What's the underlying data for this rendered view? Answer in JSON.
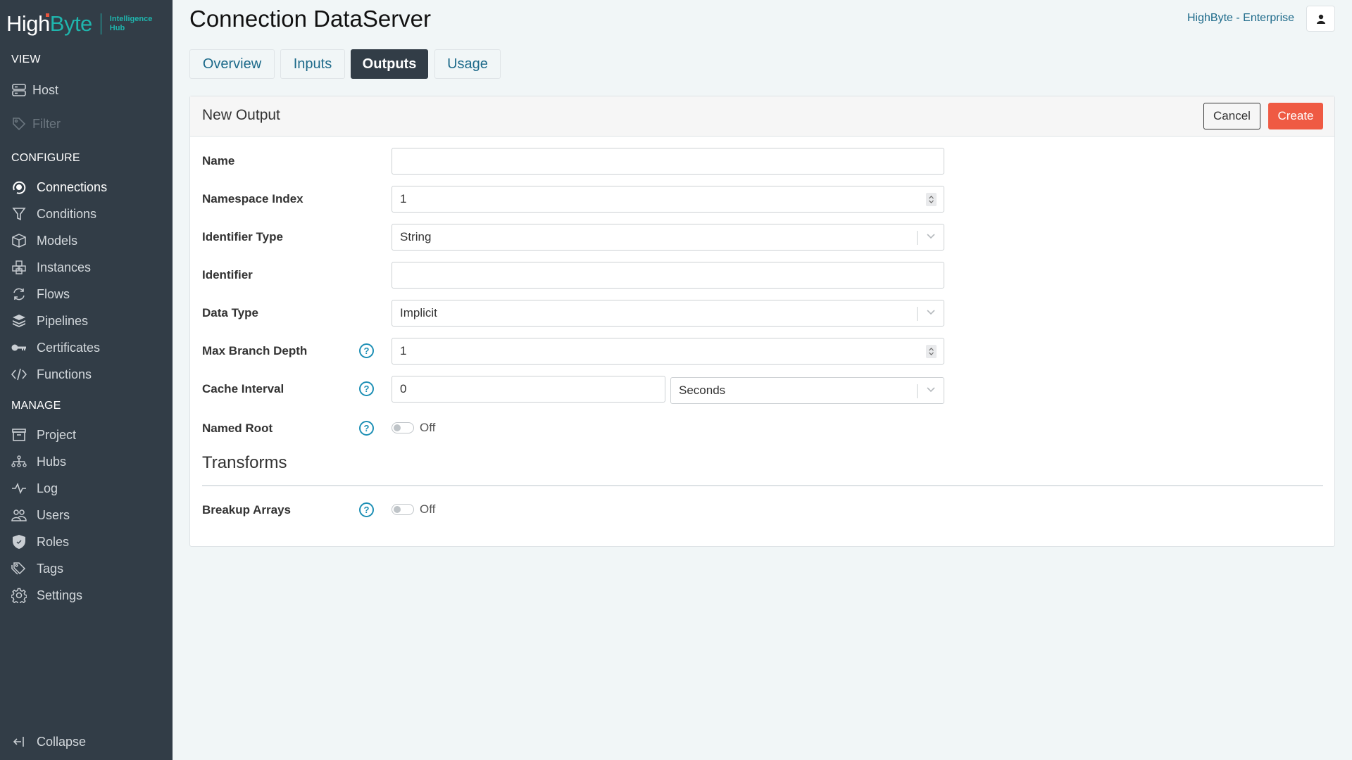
{
  "brand": {
    "name_part1": "High",
    "name_part2": "Byte",
    "subtitle_line1": "Intelligence",
    "subtitle_line2": "Hub",
    "accent_color": "#1fb5ad",
    "dot_color": "#e8553e"
  },
  "sidebar": {
    "sections": [
      {
        "label": "VIEW",
        "items": [
          {
            "label": "Host",
            "icon": "server-icon",
            "state": "normal"
          },
          {
            "label": "Filter",
            "icon": "tag-icon",
            "state": "disabled"
          }
        ]
      },
      {
        "label": "CONFIGURE",
        "items": [
          {
            "label": "Connections",
            "icon": "plug-icon",
            "state": "active"
          },
          {
            "label": "Conditions",
            "icon": "funnel-icon",
            "state": "normal"
          },
          {
            "label": "Models",
            "icon": "cube-icon",
            "state": "normal"
          },
          {
            "label": "Instances",
            "icon": "cubes-icon",
            "state": "normal"
          },
          {
            "label": "Flows",
            "icon": "sync-icon",
            "state": "normal"
          },
          {
            "label": "Pipelines",
            "icon": "layers-icon",
            "state": "normal"
          },
          {
            "label": "Certificates",
            "icon": "key-icon",
            "state": "normal"
          },
          {
            "label": "Functions",
            "icon": "code-icon",
            "state": "normal"
          }
        ]
      },
      {
        "label": "MANAGE",
        "items": [
          {
            "label": "Project",
            "icon": "archive-icon",
            "state": "normal"
          },
          {
            "label": "Hubs",
            "icon": "hierarchy-icon",
            "state": "normal"
          },
          {
            "label": "Log",
            "icon": "pulse-icon",
            "state": "normal"
          },
          {
            "label": "Users",
            "icon": "users-icon",
            "state": "normal"
          },
          {
            "label": "Roles",
            "icon": "shield-icon",
            "state": "normal"
          },
          {
            "label": "Tags",
            "icon": "tags-icon",
            "state": "normal"
          },
          {
            "label": "Settings",
            "icon": "gear-icon",
            "state": "normal"
          }
        ]
      }
    ],
    "collapse_label": "Collapse"
  },
  "header": {
    "title": "Connection DataServer",
    "tenant": "HighByte - Enterprise",
    "user_icon": "user-icon"
  },
  "tabs": [
    {
      "label": "Overview",
      "active": false
    },
    {
      "label": "Inputs",
      "active": false
    },
    {
      "label": "Outputs",
      "active": true
    },
    {
      "label": "Usage",
      "active": false
    }
  ],
  "card": {
    "title": "New Output",
    "cancel_label": "Cancel",
    "create_label": "Create",
    "create_color": "#ef5a43",
    "fields": {
      "name": {
        "label": "Name",
        "value": ""
      },
      "namespace_index": {
        "label": "Namespace Index",
        "value": "1"
      },
      "identifier_type": {
        "label": "Identifier Type",
        "value": "String"
      },
      "identifier": {
        "label": "Identifier",
        "value": ""
      },
      "data_type": {
        "label": "Data Type",
        "value": "Implicit"
      },
      "max_branch_depth": {
        "label": "Max Branch Depth",
        "value": "1"
      },
      "cache_interval": {
        "label": "Cache Interval",
        "value": "0",
        "unit": "Seconds"
      },
      "named_root": {
        "label": "Named Root",
        "state": "Off"
      }
    },
    "transforms": {
      "heading": "Transforms",
      "breakup_arrays": {
        "label": "Breakup Arrays",
        "state": "Off"
      }
    },
    "help_glyph": "?"
  }
}
